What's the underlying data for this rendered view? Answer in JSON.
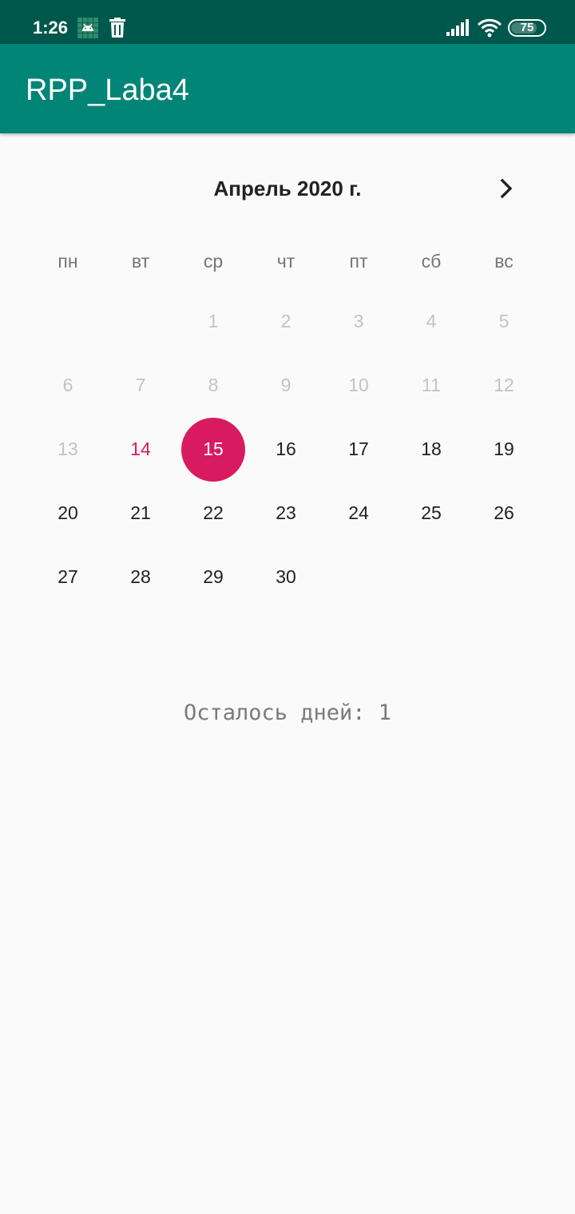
{
  "status_bar": {
    "time": "1:26",
    "battery": "75",
    "icons": [
      "android-debug-icon",
      "trash-icon",
      "signal-icon",
      "wifi-icon",
      "battery-icon"
    ]
  },
  "app_bar": {
    "title": "RPP_Laba4"
  },
  "calendar": {
    "month_title": "Апрель 2020 г.",
    "next_icon": "chevron-right-icon",
    "weekdays": [
      "пн",
      "вт",
      "ср",
      "чт",
      "пт",
      "сб",
      "вс"
    ],
    "weeks": [
      [
        "",
        "",
        "1",
        "2",
        "3",
        "4",
        "5"
      ],
      [
        "6",
        "7",
        "8",
        "9",
        "10",
        "11",
        "12"
      ],
      [
        "13",
        "14",
        "15",
        "16",
        "17",
        "18",
        "19"
      ],
      [
        "20",
        "21",
        "22",
        "23",
        "24",
        "25",
        "26"
      ],
      [
        "27",
        "28",
        "29",
        "30",
        "",
        "",
        ""
      ]
    ],
    "today": "14",
    "selected": "15"
  },
  "remaining_text": "Осталось дней: 1",
  "colors": {
    "status_bar": "#00574b",
    "app_bar": "#008577",
    "accent": "#d81b60",
    "disabled_day": "#c3c3c3"
  }
}
